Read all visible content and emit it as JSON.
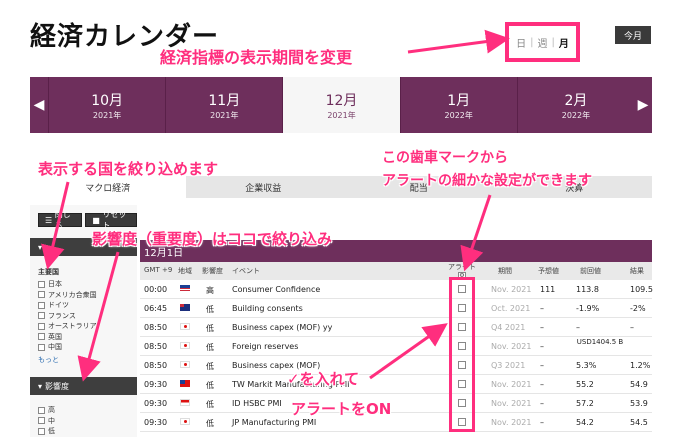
{
  "header": {
    "title": "経済カレンダー",
    "today_label": "今月"
  },
  "period_toggle": {
    "day": "日",
    "week": "週",
    "month": "月",
    "separator": "|"
  },
  "month_nav": {
    "prev_icon": "chevron-left-icon",
    "next_icon": "chevron-right-icon",
    "prev_glyph": "◀",
    "next_glyph": "▶",
    "months": [
      {
        "month": "10月",
        "year": "2021年"
      },
      {
        "month": "11月",
        "year": "2021年"
      },
      {
        "month": "12月",
        "year": "2021年"
      },
      {
        "month": "1月",
        "year": "2022年"
      },
      {
        "month": "2月",
        "year": "2022年"
      }
    ]
  },
  "subtabs": [
    "マクロ経済",
    "企業収益",
    "配当",
    "決算"
  ],
  "sidebar": {
    "close_label": "閉じる",
    "reset_label": "リセット",
    "country_group": "主要国",
    "countries": [
      "日本",
      "アメリカ合衆国",
      "ドイツ",
      "フランス",
      "オーストラリア",
      "英国",
      "中国"
    ],
    "more_label": "もっと",
    "importance_header": "影響度",
    "importance_levels": [
      "高",
      "中",
      "低"
    ]
  },
  "table": {
    "date_heading": "12月1日",
    "columns": {
      "time": "GMT +9",
      "region": "地域",
      "importance": "影響度",
      "event": "イベント",
      "alert": "アラート",
      "period": "期間",
      "forecast": "予想値",
      "previous": "前回値",
      "actual": "結果"
    },
    "rows": [
      {
        "time": "00:00",
        "flag": "us",
        "imp": "高",
        "event": "Consumer Confidence",
        "period": "Nov. 2021",
        "forecast": "111",
        "previous": "113.8",
        "actual": "109.5"
      },
      {
        "time": "06:45",
        "flag": "au",
        "imp": "低",
        "event": "Building consents",
        "period": "Oct. 2021",
        "forecast": "–",
        "previous": "-1.9%",
        "actual": "-2%"
      },
      {
        "time": "08:50",
        "flag": "jp",
        "imp": "低",
        "event": "Business capex (MOF) yy",
        "period": "Q4 2021",
        "forecast": "–",
        "previous": "–",
        "actual": "–"
      },
      {
        "time": "08:50",
        "flag": "jp",
        "imp": "低",
        "event": "Foreign reserves",
        "period": "Nov. 2021",
        "forecast": "–",
        "previous": "USD1404.5 B",
        "actual": ""
      },
      {
        "time": "08:50",
        "flag": "jp",
        "imp": "低",
        "event": "Business capex (MOF)",
        "period": "Q3 2021",
        "forecast": "–",
        "previous": "5.3%",
        "actual": "1.2%"
      },
      {
        "time": "09:30",
        "flag": "tw",
        "imp": "低",
        "event": "TW Markit Manufacturing PMI",
        "period": "Nov. 2021",
        "forecast": "–",
        "previous": "55.2",
        "actual": "54.9"
      },
      {
        "time": "09:30",
        "flag": "id",
        "imp": "低",
        "event": "ID HSBC PMI",
        "period": "Nov. 2021",
        "forecast": "–",
        "previous": "57.2",
        "actual": "53.9"
      },
      {
        "time": "09:30",
        "flag": "jp",
        "imp": "低",
        "event": "JP Manufacturing PMI",
        "period": "Nov. 2021",
        "forecast": "–",
        "previous": "54.2",
        "actual": "54.5"
      }
    ]
  },
  "annotations": {
    "period_note": "経済指標の表示期間を変更",
    "country_note": "表示する国を絞り込めます",
    "importance_note": "影響度（重要度）はココで絞り込み",
    "gear_note_1": "この歯車マークから",
    "gear_note_2": "アラートの細かな設定ができます",
    "check_note_1": "✓を入れて",
    "check_note_2": "アラートをON"
  },
  "colors": {
    "accent": "#6e2f5c",
    "annotation": "#ff2e7e"
  }
}
